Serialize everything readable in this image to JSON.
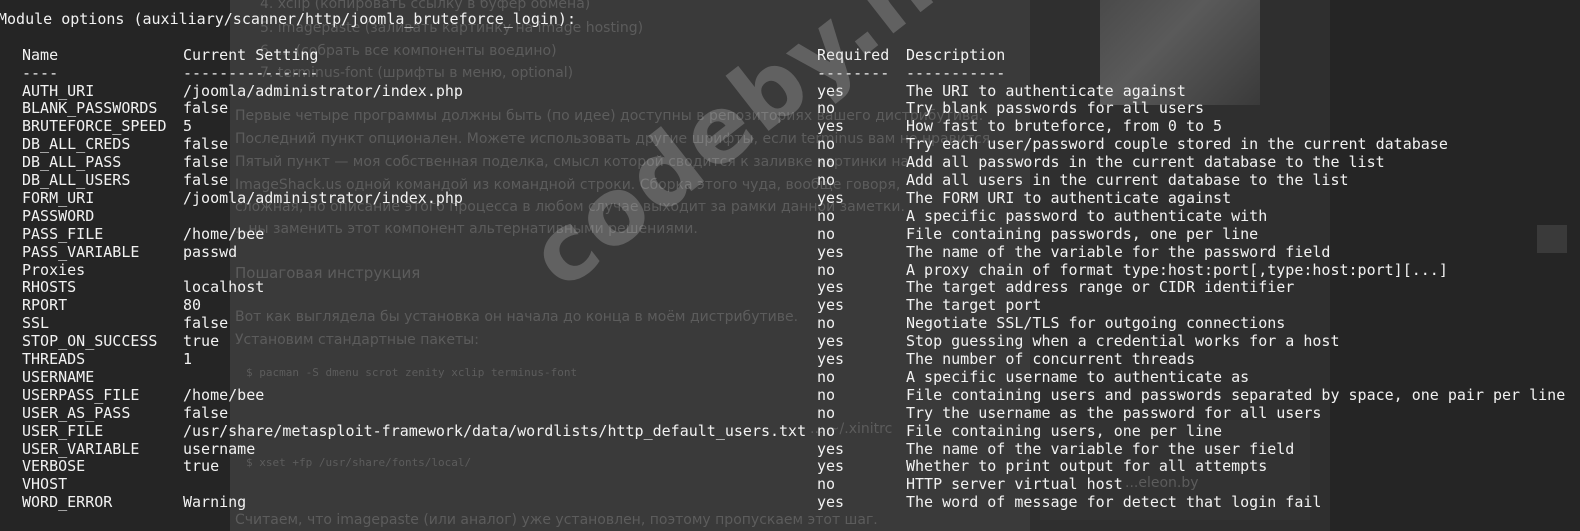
{
  "title": "Module options (auxiliary/scanner/http/joomla_bruteforce_login):",
  "columns": {
    "name": "Name",
    "setting": "Current Setting",
    "required": "Required",
    "description": "Description"
  },
  "separators": {
    "name": "----",
    "setting": "---------------",
    "required": "--------",
    "description": "-----------"
  },
  "options": [
    {
      "name": "AUTH_URI",
      "setting": "/joomla/administrator/index.php",
      "required": "yes",
      "description": "The URI to authenticate against"
    },
    {
      "name": "BLANK_PASSWORDS",
      "setting": "false",
      "required": "no",
      "description": "Try blank passwords for all users"
    },
    {
      "name": "BRUTEFORCE_SPEED",
      "setting": "5",
      "required": "yes",
      "description": "How fast to bruteforce, from 0 to 5"
    },
    {
      "name": "DB_ALL_CREDS",
      "setting": "false",
      "required": "no",
      "description": "Try each user/password couple stored in the current database"
    },
    {
      "name": "DB_ALL_PASS",
      "setting": "false",
      "required": "no",
      "description": "Add all passwords in the current database to the list"
    },
    {
      "name": "DB_ALL_USERS",
      "setting": "false",
      "required": "no",
      "description": "Add all users in the current database to the list"
    },
    {
      "name": "FORM_URI",
      "setting": "/joomla/administrator/index.php",
      "required": "yes",
      "description": "The FORM URI to authenticate against"
    },
    {
      "name": "PASSWORD",
      "setting": "",
      "required": "no",
      "description": "A specific password to authenticate with"
    },
    {
      "name": "PASS_FILE",
      "setting": "/home/bee",
      "required": "no",
      "description": "File containing passwords, one per line"
    },
    {
      "name": "PASS_VARIABLE",
      "setting": "passwd",
      "required": "yes",
      "description": "The name of the variable for the password field"
    },
    {
      "name": "Proxies",
      "setting": "",
      "required": "no",
      "description": "A proxy chain of format type:host:port[,type:host:port][...]"
    },
    {
      "name": "RHOSTS",
      "setting": "localhost",
      "required": "yes",
      "description": "The target address range or CIDR identifier"
    },
    {
      "name": "RPORT",
      "setting": "80",
      "required": "yes",
      "description": "The target port"
    },
    {
      "name": "SSL",
      "setting": "false",
      "required": "no",
      "description": "Negotiate SSL/TLS for outgoing connections"
    },
    {
      "name": "STOP_ON_SUCCESS",
      "setting": "true",
      "required": "yes",
      "description": "Stop guessing when a credential works for a host"
    },
    {
      "name": "THREADS",
      "setting": "1",
      "required": "yes",
      "description": "The number of concurrent threads"
    },
    {
      "name": "USERNAME",
      "setting": "",
      "required": "no",
      "description": "A specific username to authenticate as"
    },
    {
      "name": "USERPASS_FILE",
      "setting": "/home/bee",
      "required": "no",
      "description": "File containing users and passwords separated by space, one pair per line"
    },
    {
      "name": "USER_AS_PASS",
      "setting": "false",
      "required": "no",
      "description": "Try the username as the password for all users"
    },
    {
      "name": "USER_FILE",
      "setting": "/usr/share/metasploit-framework/data/wordlists/http_default_users.txt",
      "required": "no",
      "description": "File containing users, one per line"
    },
    {
      "name": "USER_VARIABLE",
      "setting": "username",
      "required": "yes",
      "description": "The name of the variable for the user field"
    },
    {
      "name": "VERBOSE",
      "setting": "true",
      "required": "yes",
      "description": "Whether to print output for all attempts"
    },
    {
      "name": "VHOST",
      "setting": "",
      "required": "no",
      "description": "HTTP server virtual host"
    },
    {
      "name": "WORD_ERROR",
      "setting": "Warning",
      "required": "yes",
      "description": "The word of message for detect that login fail"
    }
  ],
  "background_page": {
    "lines": [
      "4. xclip (копировать ссылку в буфер обмена)",
      "5. imagepaste (заливать картинку на image hosting)",
      "6. ... (собрать все компоненты воедино)",
      "7. terminus-font (шрифты в меню, optional)",
      "Первые четыре программы должны быть (по идее) доступны в репозиториях вашего дистрибутива.",
      "Последний пункт опционален. Можете использовать другие шрифты, если terminus вам не нравится.",
      "Пятый пункт — моя собственная поделка, смысл которой сводится к заливке картинки на",
      "ImageShack.us одной командой из командной строки. Сборка этого чуда, вообще говоря,",
      "сложная, но описание этого процесса в любом случае выходит за рамки данной заметки.",
      "...ны заменить этот компонент альтернативными решениями.",
      "Пошаговая инструкция",
      "Вот как выглядела бы установка он начала до конца в моём дистрибутиве.",
      "Установим стандартные пакеты:",
      "$ pacman -S dmenu scrot zenity xclip terminus-font",
      "... ~/.xinitrc",
      "$ xset +fp /usr/share/fonts/local/",
      "Считаем, что imagepaste (или аналог) уже установлен, поэтому пропускаем этот шаг.",
      "...eleon.by"
    ]
  },
  "watermark": "codeby.net"
}
